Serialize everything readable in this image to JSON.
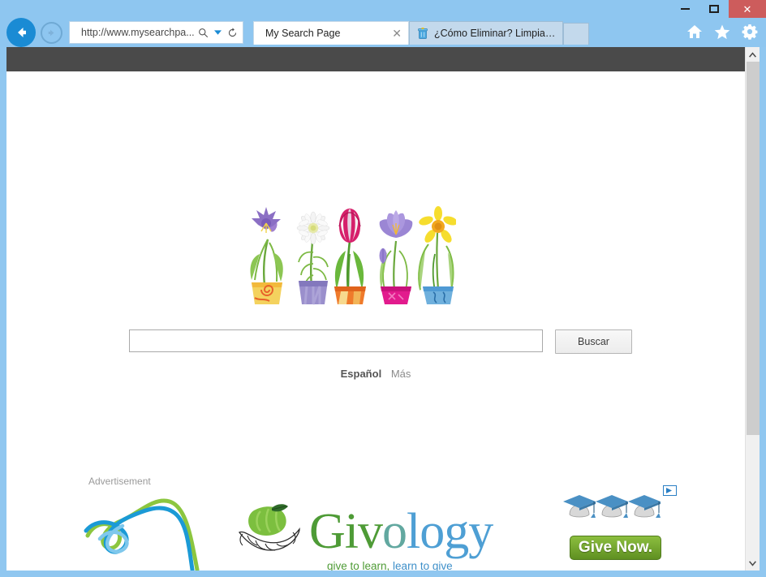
{
  "browser": {
    "window_controls": {
      "minimize": "—",
      "maximize": "□",
      "close": "✕"
    },
    "back_icon": "back-arrow-icon",
    "forward_icon": "forward-arrow-icon",
    "address": {
      "url": "http://www.mysearchpa...",
      "search_icon": "search-icon",
      "dropdown_icon": "chevron-down-icon",
      "refresh_icon": "refresh-icon"
    },
    "tabs": [
      {
        "label": "My Search Page",
        "close_label": "✕",
        "active": true,
        "favicon": "none"
      },
      {
        "label": "¿Cómo Eliminar? Limpiar su co...",
        "close_label": "",
        "active": false,
        "favicon": "trash-bin-icon"
      }
    ],
    "new_tab_label": "",
    "command_icons": [
      "home-icon",
      "favorites-star-icon",
      "settings-gear-icon"
    ],
    "scrollbar": {
      "up_arrow": "⌃",
      "down_arrow": "⌄"
    }
  },
  "page": {
    "hero_image_alt": "five-potted-flowers",
    "flowers": [
      {
        "name": "bellflower",
        "petal_color": "#8b6fc4",
        "pot_color": "#f2c44a"
      },
      {
        "name": "daisy",
        "petal_color": "#f2f2f2",
        "pot_color": "#8f85c6"
      },
      {
        "name": "tulip",
        "petal_color": "#d6206b",
        "pot_color": "#e8671f"
      },
      {
        "name": "crocus",
        "petal_color": "#9b86d4",
        "pot_color": "#e21b8d"
      },
      {
        "name": "daffodil",
        "petal_color": "#f2d019",
        "pot_color": "#4f9ad4"
      }
    ],
    "search": {
      "value": "",
      "placeholder": "",
      "button_label": "Buscar"
    },
    "language": {
      "primary": "Español",
      "more": "Más"
    },
    "advertisement": {
      "label": "Advertisement",
      "ribbon_ad": {
        "name": "ribbon-swirl-logo",
        "green": "#8cc63f",
        "blue": "#1b9ad6",
        "light_blue": "#7fc8ec"
      },
      "givology_ad": {
        "logo_alt": "hands-holding-apple-icon",
        "wordmark_part1": "Giv",
        "wordmark_part2": "o",
        "wordmark_part3": "logy",
        "tagline_green": "give to learn,",
        "tagline_blue": " learn to give",
        "colors": {
          "green": "#4e9b36",
          "blue": "#4e9fd4"
        }
      },
      "give_now_ad": {
        "button_label": "Give Now.",
        "graduation_caps": 3,
        "cap_color": "#4a90c4",
        "adchoices_icon": "adchoices-triangle-icon"
      }
    }
  }
}
